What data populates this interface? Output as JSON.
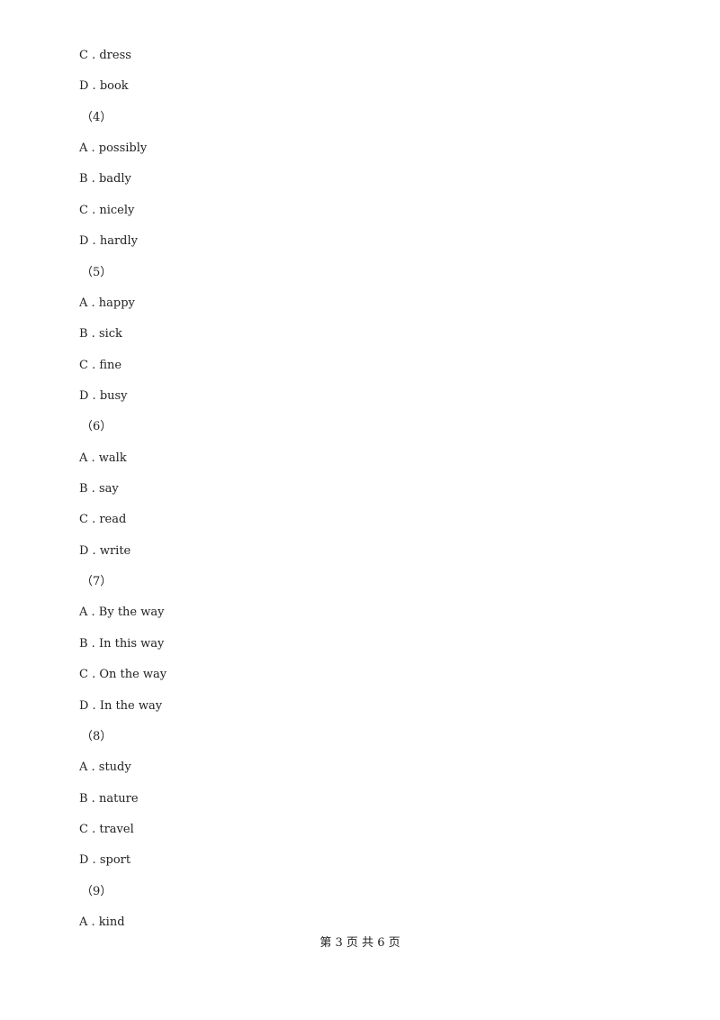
{
  "lines": [
    {
      "type": "option",
      "text": "C . dress"
    },
    {
      "type": "option",
      "text": "D . book"
    },
    {
      "type": "question",
      "text": "（4）"
    },
    {
      "type": "option",
      "text": "A . possibly"
    },
    {
      "type": "option",
      "text": "B . badly"
    },
    {
      "type": "option",
      "text": "C . nicely"
    },
    {
      "type": "option",
      "text": "D . hardly"
    },
    {
      "type": "question",
      "text": "（5）"
    },
    {
      "type": "option",
      "text": "A . happy"
    },
    {
      "type": "option",
      "text": "B . sick"
    },
    {
      "type": "option",
      "text": "C . fine"
    },
    {
      "type": "option",
      "text": "D . busy"
    },
    {
      "type": "question",
      "text": "（6）"
    },
    {
      "type": "option",
      "text": "A . walk"
    },
    {
      "type": "option",
      "text": "B . say"
    },
    {
      "type": "option",
      "text": "C . read"
    },
    {
      "type": "option",
      "text": "D . write"
    },
    {
      "type": "question",
      "text": "（7）"
    },
    {
      "type": "option",
      "text": "A . By the way"
    },
    {
      "type": "option",
      "text": "B . In this way"
    },
    {
      "type": "option",
      "text": "C . On the way"
    },
    {
      "type": "option",
      "text": "D . In the way"
    },
    {
      "type": "question",
      "text": "（8）"
    },
    {
      "type": "option",
      "text": "A . study"
    },
    {
      "type": "option",
      "text": "B . nature"
    },
    {
      "type": "option",
      "text": "C . travel"
    },
    {
      "type": "option",
      "text": "D . sport"
    },
    {
      "type": "question",
      "text": "（9）"
    },
    {
      "type": "option",
      "text": "A . kind"
    }
  ],
  "footer": "第 3 页 共 6 页"
}
